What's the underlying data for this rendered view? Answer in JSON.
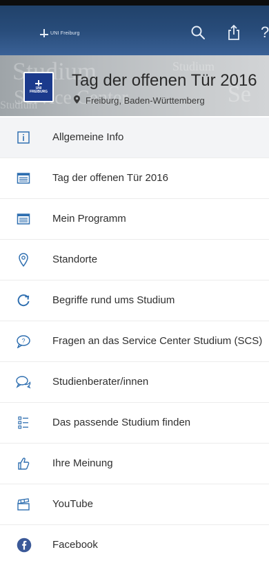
{
  "header": {
    "brand": "UNI Freiburg",
    "icons": [
      "search-icon",
      "share-icon",
      "more-icon"
    ]
  },
  "banner": {
    "title": "Tag der offenen Tür 2016",
    "location": "Freiburg, Baden-Württemberg",
    "logo_text_line1": "UNI",
    "logo_text_line2": "FREIBURG",
    "ghost_1": "Studium",
    "ghost_2": "Service Center",
    "ghost_3": "Studium",
    "ghost_4": "Se",
    "ghost_5": "Studium"
  },
  "menu": {
    "items": [
      {
        "label": "Allgemeine Info",
        "icon": "info-icon"
      },
      {
        "label": "Tag der offenen Tür 2016",
        "icon": "calendar-list-icon"
      },
      {
        "label": "Mein Programm",
        "icon": "calendar-list-icon"
      },
      {
        "label": "Standorte",
        "icon": "map-pin-icon"
      },
      {
        "label": "Begriffe rund ums Studium",
        "icon": "refresh-icon"
      },
      {
        "label": "Fragen an das Service Center Studium (SCS)",
        "icon": "question-bubble-icon"
      },
      {
        "label": "Studienberater/innen",
        "icon": "chat-bubbles-icon"
      },
      {
        "label": "Das passende Studium finden",
        "icon": "checklist-icon"
      },
      {
        "label": "Ihre Meinung",
        "icon": "thumbs-up-icon"
      },
      {
        "label": "YouTube",
        "icon": "clapperboard-icon"
      },
      {
        "label": "Facebook",
        "icon": "facebook-icon"
      }
    ]
  },
  "colors": {
    "header": "#284c7a",
    "accent_icon": "#2f6fb0",
    "facebook": "#3b5998"
  }
}
